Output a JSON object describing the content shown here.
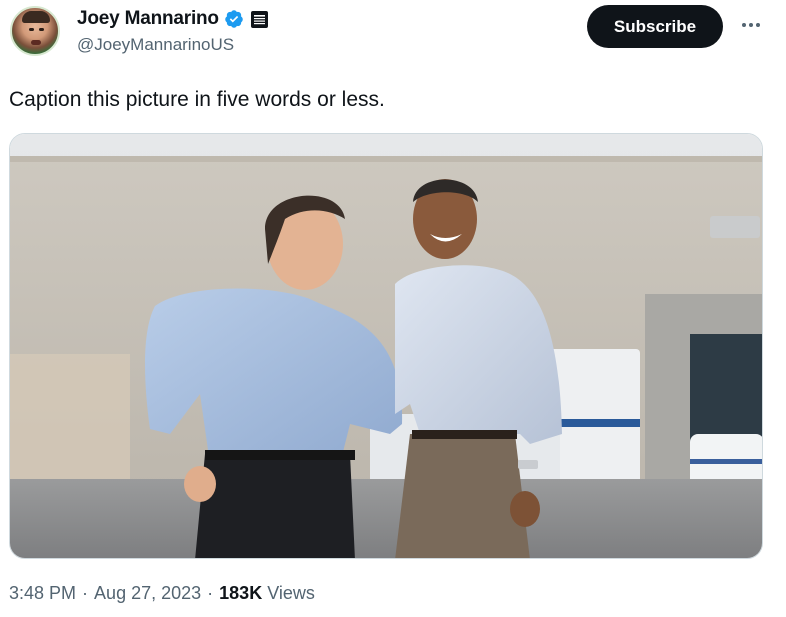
{
  "author": {
    "display_name": "Joey Mannarino",
    "handle": "@JoeyMannarinoUS",
    "verified": true,
    "verified_color": "#1d9bf0",
    "affiliate_badge_icon": "affiliate-badge-icon",
    "avatar_icon": "avatar"
  },
  "actions": {
    "subscribe_label": "Subscribe",
    "more_icon": "more-options-icon"
  },
  "tweet": {
    "text": "Caption this picture in five words or less.",
    "media_icon": "photo"
  },
  "meta": {
    "time": "3:48 PM",
    "separator1": "·",
    "date": "Aug 27, 2023",
    "separator2": "·",
    "views_count": "183K",
    "views_label": "Views"
  },
  "colors": {
    "text_primary": "#0f1419",
    "text_secondary": "#536471",
    "button_bg": "#0f1419"
  }
}
